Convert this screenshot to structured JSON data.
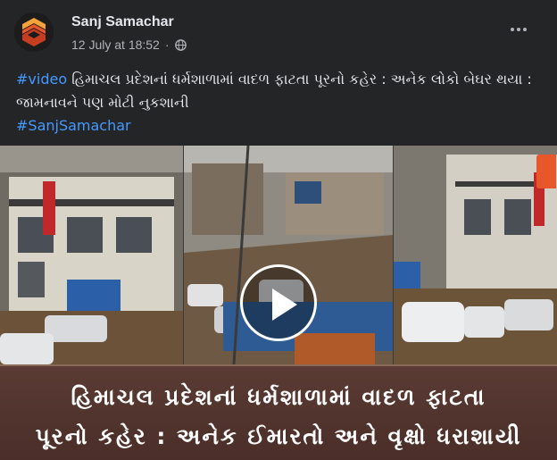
{
  "post": {
    "page_name": "Sanj Samachar",
    "date": "12 July at 18:52",
    "separator": "·",
    "audience_icon": "globe-icon",
    "more_icon": "more-options-icon",
    "caption": {
      "hashtag_video": "#video",
      "text_line": " હિમાચલ પ્રદેશનાં ધર્મશાળામાં વાદળ ફાટતા પૂરનો કહેર : અનેક લોકો બેઘર થયા : જામનાવને પણ મોટી નુકશાની",
      "hashtag_page": "#SanjSamachar"
    },
    "colors": {
      "link": "#4599ff",
      "background": "#242526",
      "banner": "#4b2e29",
      "logo_orange": "#e8572a"
    }
  },
  "media": {
    "play_icon": "play-icon",
    "banner_line_1": "હિમાચલ પ્રદેશનાં ધર્મશાળામાં વાદળ ફાટતા",
    "banner_line_2": "પૂરનો કહેર : અનેક ઈમારતો અને વૃક્ષો ધરાશાયી"
  }
}
